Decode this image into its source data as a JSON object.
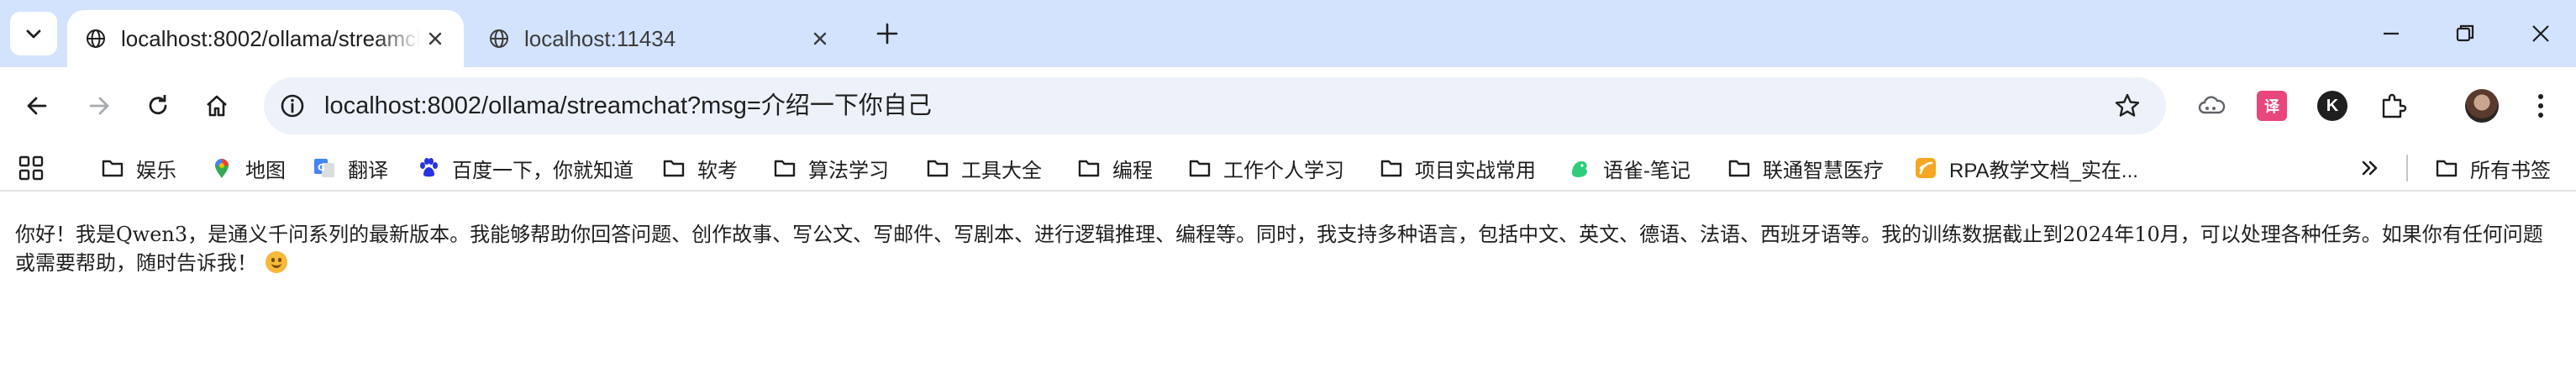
{
  "browser": {
    "tabs": [
      {
        "title": "localhost:8002/ollama/streamchat?msg=介绍一下你自己",
        "active": true
      },
      {
        "title": "localhost:11434",
        "active": false
      }
    ],
    "address_bar": {
      "url": "localhost:8002/ollama/streamchat?msg=介绍一下你自己"
    },
    "bookmarks": [
      {
        "label": "娱乐",
        "icon": "folder-icon"
      },
      {
        "label": "地图",
        "icon": "google-maps-icon"
      },
      {
        "label": "翻译",
        "icon": "google-translate-icon"
      },
      {
        "label": "百度一下，你就知道",
        "icon": "baidu-paw-icon"
      },
      {
        "label": "软考",
        "icon": "folder-icon"
      },
      {
        "label": "算法学习",
        "icon": "folder-icon"
      },
      {
        "label": "工具大全",
        "icon": "folder-icon"
      },
      {
        "label": "编程",
        "icon": "folder-icon"
      },
      {
        "label": "工作个人学习",
        "icon": "folder-icon"
      },
      {
        "label": "项目实战常用",
        "icon": "folder-icon"
      },
      {
        "label": "语雀-笔记",
        "icon": "yuque-bird-icon"
      },
      {
        "label": "联通智慧医疗",
        "icon": "folder-icon"
      },
      {
        "label": "RPA教学文档_实在...",
        "icon": "rpa-orange-icon"
      }
    ],
    "all_bookmarks_label": "所有书签"
  },
  "page": {
    "text": "你好！我是Qwen3，是通义千问系列的最新版本。我能够帮助你回答问题、创作故事、写公文、写邮件、写剧本、进行逻辑推理、编程等。同时，我支持多种语言，包括中文、英文、德语、法语、西班牙语等。我的训练数据截止到2024年10月，可以处理各种任务。如果你有任何问题或需要帮助，随时告诉我！"
  },
  "colors": {
    "tabstrip_bg": "#d3e3fd",
    "omnibox_bg": "#edf2fa",
    "text": "#1f1f1f"
  }
}
